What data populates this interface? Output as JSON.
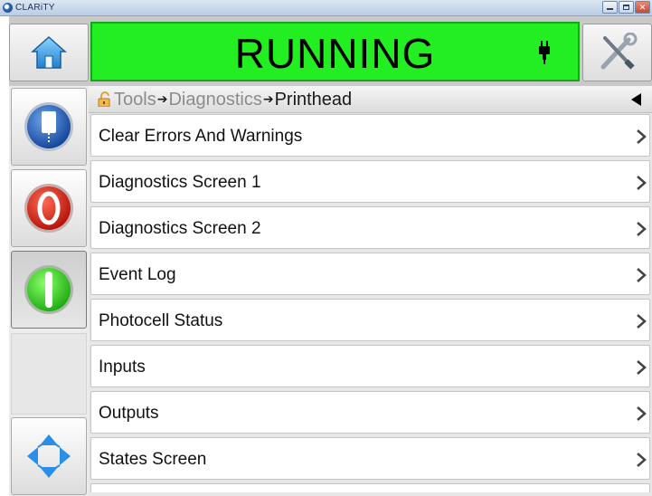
{
  "window": {
    "title": "CLARiTY"
  },
  "header": {
    "status": "RUNNING",
    "status_color": "#22ee22"
  },
  "breadcrumb": {
    "items": [
      "Tools",
      "Diagnostics",
      "Printhead"
    ]
  },
  "menu": {
    "items": [
      {
        "label": "Clear Errors And Warnings"
      },
      {
        "label": "Diagnostics Screen 1"
      },
      {
        "label": "Diagnostics Screen 2"
      },
      {
        "label": "Event Log"
      },
      {
        "label": "Photocell Status"
      },
      {
        "label": "Inputs"
      },
      {
        "label": "Outputs"
      },
      {
        "label": "States Screen"
      }
    ]
  },
  "icons": {
    "home": "home-icon",
    "tools": "wrench-screwdriver-icon",
    "job": "job-select-icon",
    "stop": "stop-icon",
    "start": "start-icon",
    "navigate": "navigation-arrows-icon",
    "plug": "plug-icon",
    "lock": "unlock-icon",
    "back": "back-triangle-icon",
    "chevron": "chevron-right-icon"
  }
}
